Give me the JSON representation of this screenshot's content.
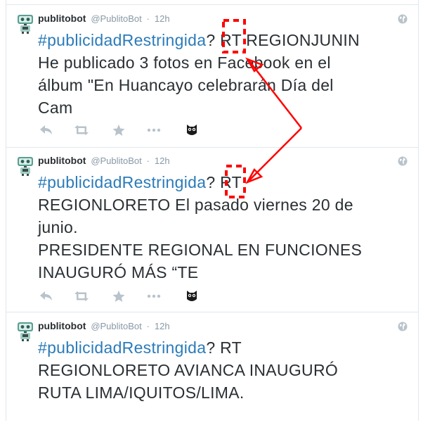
{
  "tweets": [
    {
      "name": "publitobot",
      "handle": "@PublitoBot",
      "separator": "·",
      "time": "12h",
      "hashtag": "#publicidadRestringida",
      "line1_rest": "? RT REGIONJUNIN",
      "lines": [
        "He publicado 3 fotos en Facebook en el",
        "álbum \"En Huancayo celebrarán Día del",
        "Cam"
      ]
    },
    {
      "name": "publitobot",
      "handle": "@PublitoBot",
      "separator": "·",
      "time": "12h",
      "hashtag": "#publicidadRestringida",
      "line1_rest": "? RT",
      "lines": [
        "REGIONLORETO El pasado viernes 20 de",
        "junio.",
        "PRESIDENTE REGIONAL EN FUNCIONES",
        "INAUGURÓ MÁS “TE"
      ]
    },
    {
      "name": "publitobot",
      "handle": "@PublitoBot",
      "separator": "·",
      "time": "12h",
      "hashtag": "#publicidadRestringida",
      "line1_rest": "? RT",
      "lines": [
        "REGIONLORETO AVIANCA INAUGURÓ",
        "RUTA LIMA/IQUITOS/LIMA."
      ]
    }
  ],
  "icons": {
    "avatar": "robot-avatar-icon",
    "globe": "globe-icon",
    "reply": "reply-icon",
    "retweet": "retweet-icon",
    "favorite": "star-icon",
    "more": "more-icon",
    "owl": "owl-icon"
  },
  "colors": {
    "hashtag": "#2b7bb9",
    "meta_text": "#8899a6",
    "action_icon": "#b8c3cb",
    "annotation": "#ff0000",
    "divider": "#e1e8ed"
  }
}
